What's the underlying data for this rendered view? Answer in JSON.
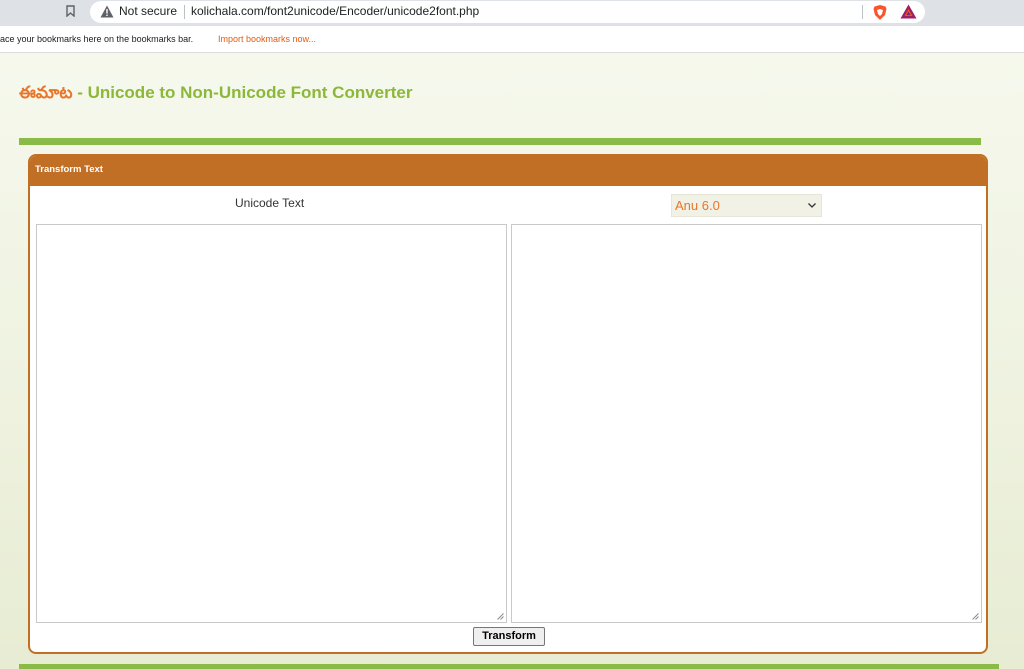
{
  "browser": {
    "security_label": "Not secure",
    "url": "kolichala.com/font2unicode/Encoder/unicode2font.php",
    "bookmarks_message": "ace your bookmarks here on the bookmarks bar.",
    "import_bookmarks": "Import bookmarks now..."
  },
  "page": {
    "brand": "ఈమాట",
    "title": "- Unicode to Non-Unicode Font Converter"
  },
  "panel": {
    "header": "Transform Text",
    "input_label": "Unicode Text",
    "font_selected": "Anu 6.0",
    "input_text": "",
    "output_text": "",
    "transform_label": "Transform"
  },
  "colors": {
    "accent_orange": "#c06f25",
    "title_green": "#8cb83a",
    "brand_orange": "#e8762b",
    "rule_green": "#8bbb47"
  }
}
